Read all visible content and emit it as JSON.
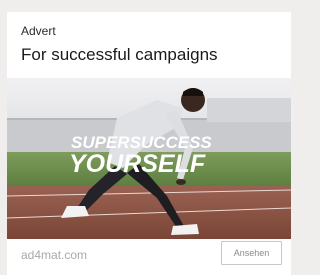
{
  "ad": {
    "sponsor_label": "Advert",
    "headline": "For successful campaigns",
    "image": {
      "line1": "SUPERSUCCESS",
      "line2": "YOURSELF",
      "subject": "sprinter-in-starting-position"
    },
    "domain": "ad4mat.com",
    "cta_label": "Ansehen"
  },
  "colors": {
    "page_background": "#efeeec",
    "card_background": "#ffffff",
    "track": "#8c5549",
    "grass": "#6b8f4b",
    "sky": "#e8e8ea"
  }
}
